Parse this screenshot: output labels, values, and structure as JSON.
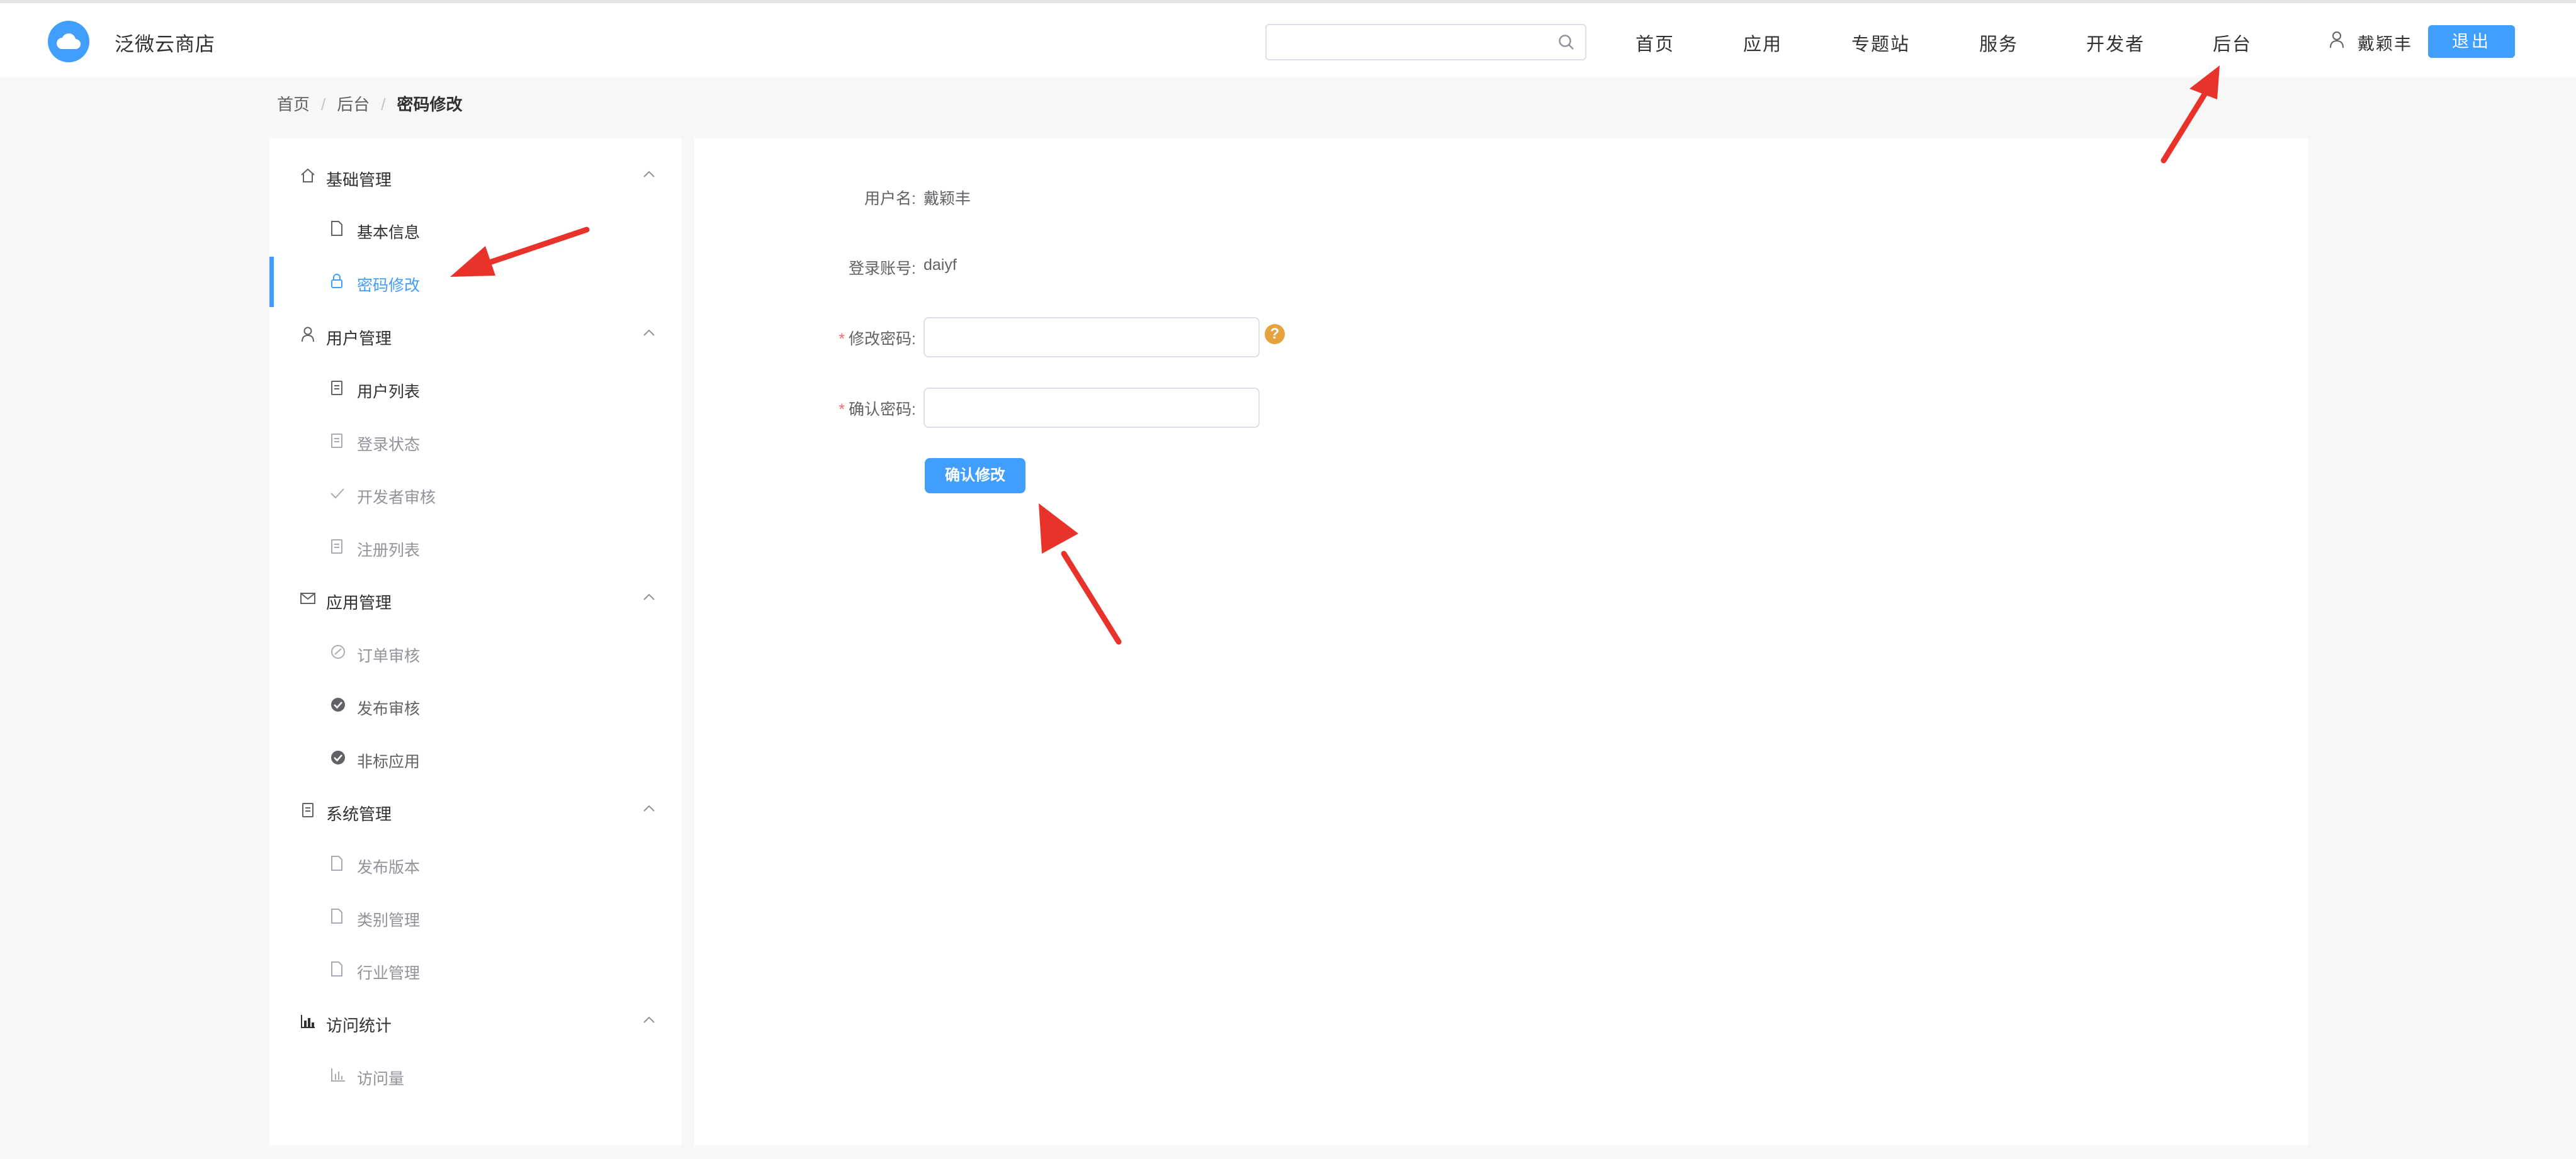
{
  "app": {
    "title": "泛微云商店"
  },
  "search": {
    "placeholder": ""
  },
  "nav": [
    "首页",
    "应用",
    "专题站",
    "服务",
    "开发者",
    "后台"
  ],
  "user": {
    "name": "戴颖丰",
    "logout_label": "退出"
  },
  "breadcrumb": [
    "首页",
    "后台",
    "密码修改"
  ],
  "sidebar": {
    "groups": [
      {
        "label": "基础管理",
        "icon": "home-icon",
        "items": [
          {
            "label": "基本信息",
            "icon": "document-icon"
          },
          {
            "label": "密码修改",
            "icon": "lock-icon",
            "active": true
          }
        ]
      },
      {
        "label": "用户管理",
        "icon": "user-icon",
        "items": [
          {
            "label": "用户列表",
            "icon": "clipboard-icon"
          },
          {
            "label": "登录状态",
            "icon": "clipboard-icon"
          },
          {
            "label": "开发者审核",
            "icon": "check-icon"
          },
          {
            "label": "注册列表",
            "icon": "clipboard-icon"
          }
        ]
      },
      {
        "label": "应用管理",
        "icon": "mail-icon",
        "items": [
          {
            "label": "订单审核",
            "icon": "circle-check-outline-icon"
          },
          {
            "label": "发布审核",
            "icon": "circle-check-filled-icon"
          },
          {
            "label": "非标应用",
            "icon": "circle-check-filled-icon"
          }
        ]
      },
      {
        "label": "系统管理",
        "icon": "clipboard-icon",
        "items": [
          {
            "label": "发布版本",
            "icon": "document-icon"
          },
          {
            "label": "类别管理",
            "icon": "document-icon"
          },
          {
            "label": "行业管理",
            "icon": "document-icon"
          }
        ]
      },
      {
        "label": "访问统计",
        "icon": "bar-chart-icon",
        "items": [
          {
            "label": "访问量",
            "icon": "bar-chart-icon"
          }
        ]
      }
    ]
  },
  "form": {
    "username_label": "用户名:",
    "username_value": "戴颖丰",
    "account_label": "登录账号:",
    "account_value": "daiyf",
    "new_password_label": "修改密码:",
    "confirm_password_label": "确认密码:",
    "new_password_value": "",
    "confirm_password_value": "",
    "required_mark": "*",
    "help_mark": "?",
    "submit_label": "确认修改"
  },
  "colors": {
    "accent": "#409eff",
    "warning": "#e6a23c",
    "required": "#f56c6c",
    "annotation_arrow": "#e8322a"
  }
}
